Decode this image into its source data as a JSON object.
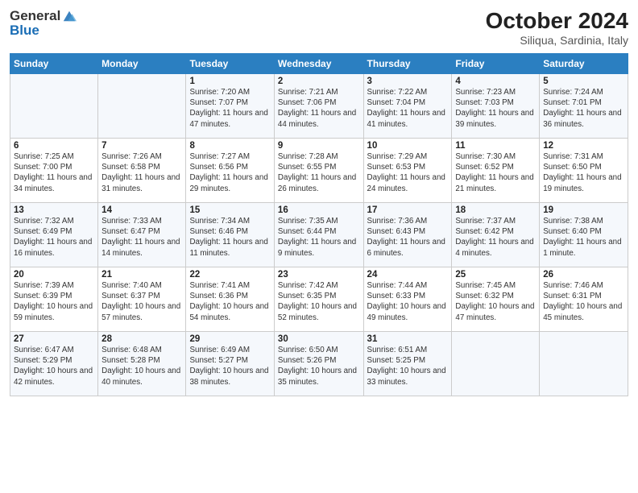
{
  "header": {
    "logo_line1": "General",
    "logo_line2": "Blue",
    "month": "October 2024",
    "location": "Siliqua, Sardinia, Italy"
  },
  "days_of_week": [
    "Sunday",
    "Monday",
    "Tuesday",
    "Wednesday",
    "Thursday",
    "Friday",
    "Saturday"
  ],
  "weeks": [
    [
      {
        "day": "",
        "info": ""
      },
      {
        "day": "",
        "info": ""
      },
      {
        "day": "1",
        "info": "Sunrise: 7:20 AM\nSunset: 7:07 PM\nDaylight: 11 hours and 47 minutes."
      },
      {
        "day": "2",
        "info": "Sunrise: 7:21 AM\nSunset: 7:06 PM\nDaylight: 11 hours and 44 minutes."
      },
      {
        "day": "3",
        "info": "Sunrise: 7:22 AM\nSunset: 7:04 PM\nDaylight: 11 hours and 41 minutes."
      },
      {
        "day": "4",
        "info": "Sunrise: 7:23 AM\nSunset: 7:03 PM\nDaylight: 11 hours and 39 minutes."
      },
      {
        "day": "5",
        "info": "Sunrise: 7:24 AM\nSunset: 7:01 PM\nDaylight: 11 hours and 36 minutes."
      }
    ],
    [
      {
        "day": "6",
        "info": "Sunrise: 7:25 AM\nSunset: 7:00 PM\nDaylight: 11 hours and 34 minutes."
      },
      {
        "day": "7",
        "info": "Sunrise: 7:26 AM\nSunset: 6:58 PM\nDaylight: 11 hours and 31 minutes."
      },
      {
        "day": "8",
        "info": "Sunrise: 7:27 AM\nSunset: 6:56 PM\nDaylight: 11 hours and 29 minutes."
      },
      {
        "day": "9",
        "info": "Sunrise: 7:28 AM\nSunset: 6:55 PM\nDaylight: 11 hours and 26 minutes."
      },
      {
        "day": "10",
        "info": "Sunrise: 7:29 AM\nSunset: 6:53 PM\nDaylight: 11 hours and 24 minutes."
      },
      {
        "day": "11",
        "info": "Sunrise: 7:30 AM\nSunset: 6:52 PM\nDaylight: 11 hours and 21 minutes."
      },
      {
        "day": "12",
        "info": "Sunrise: 7:31 AM\nSunset: 6:50 PM\nDaylight: 11 hours and 19 minutes."
      }
    ],
    [
      {
        "day": "13",
        "info": "Sunrise: 7:32 AM\nSunset: 6:49 PM\nDaylight: 11 hours and 16 minutes."
      },
      {
        "day": "14",
        "info": "Sunrise: 7:33 AM\nSunset: 6:47 PM\nDaylight: 11 hours and 14 minutes."
      },
      {
        "day": "15",
        "info": "Sunrise: 7:34 AM\nSunset: 6:46 PM\nDaylight: 11 hours and 11 minutes."
      },
      {
        "day": "16",
        "info": "Sunrise: 7:35 AM\nSunset: 6:44 PM\nDaylight: 11 hours and 9 minutes."
      },
      {
        "day": "17",
        "info": "Sunrise: 7:36 AM\nSunset: 6:43 PM\nDaylight: 11 hours and 6 minutes."
      },
      {
        "day": "18",
        "info": "Sunrise: 7:37 AM\nSunset: 6:42 PM\nDaylight: 11 hours and 4 minutes."
      },
      {
        "day": "19",
        "info": "Sunrise: 7:38 AM\nSunset: 6:40 PM\nDaylight: 11 hours and 1 minute."
      }
    ],
    [
      {
        "day": "20",
        "info": "Sunrise: 7:39 AM\nSunset: 6:39 PM\nDaylight: 10 hours and 59 minutes."
      },
      {
        "day": "21",
        "info": "Sunrise: 7:40 AM\nSunset: 6:37 PM\nDaylight: 10 hours and 57 minutes."
      },
      {
        "day": "22",
        "info": "Sunrise: 7:41 AM\nSunset: 6:36 PM\nDaylight: 10 hours and 54 minutes."
      },
      {
        "day": "23",
        "info": "Sunrise: 7:42 AM\nSunset: 6:35 PM\nDaylight: 10 hours and 52 minutes."
      },
      {
        "day": "24",
        "info": "Sunrise: 7:44 AM\nSunset: 6:33 PM\nDaylight: 10 hours and 49 minutes."
      },
      {
        "day": "25",
        "info": "Sunrise: 7:45 AM\nSunset: 6:32 PM\nDaylight: 10 hours and 47 minutes."
      },
      {
        "day": "26",
        "info": "Sunrise: 7:46 AM\nSunset: 6:31 PM\nDaylight: 10 hours and 45 minutes."
      }
    ],
    [
      {
        "day": "27",
        "info": "Sunrise: 6:47 AM\nSunset: 5:29 PM\nDaylight: 10 hours and 42 minutes."
      },
      {
        "day": "28",
        "info": "Sunrise: 6:48 AM\nSunset: 5:28 PM\nDaylight: 10 hours and 40 minutes."
      },
      {
        "day": "29",
        "info": "Sunrise: 6:49 AM\nSunset: 5:27 PM\nDaylight: 10 hours and 38 minutes."
      },
      {
        "day": "30",
        "info": "Sunrise: 6:50 AM\nSunset: 5:26 PM\nDaylight: 10 hours and 35 minutes."
      },
      {
        "day": "31",
        "info": "Sunrise: 6:51 AM\nSunset: 5:25 PM\nDaylight: 10 hours and 33 minutes."
      },
      {
        "day": "",
        "info": ""
      },
      {
        "day": "",
        "info": ""
      }
    ]
  ]
}
